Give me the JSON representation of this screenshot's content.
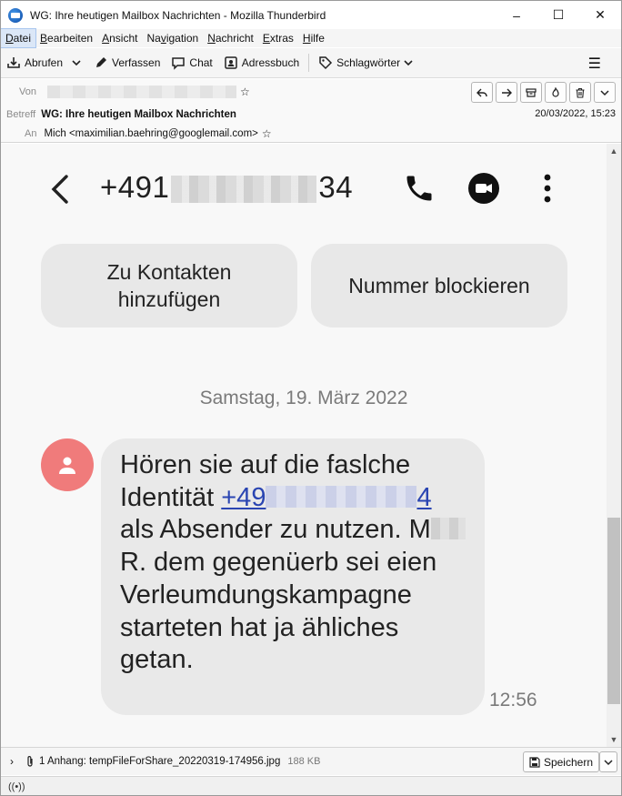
{
  "window": {
    "title": "WG: Ihre heutigen Mailbox Nachrichten - Mozilla Thunderbird",
    "minimize": "–",
    "maximize": "☐",
    "close": "✕"
  },
  "menubar": {
    "items": [
      {
        "first": "D",
        "rest": "atei"
      },
      {
        "first": "B",
        "rest": "earbeiten"
      },
      {
        "first": "A",
        "rest": "nsicht"
      },
      {
        "pre": "Na",
        "first": "v",
        "rest": "igation"
      },
      {
        "first": "N",
        "rest": "achricht"
      },
      {
        "first": "E",
        "rest": "xtras"
      },
      {
        "first": "H",
        "rest": "ilfe"
      }
    ]
  },
  "toolbar": {
    "get_mail": "Abrufen",
    "compose": "Verfassen",
    "chat": "Chat",
    "address_book": "Adressbuch",
    "tags": "Schlagwörter",
    "menu_icon": "☰"
  },
  "header": {
    "from_label": "Von",
    "subject_label": "Betreff",
    "subject": "WG: Ihre heutigen Mailbox Nachrichten",
    "date": "20/03/2022, 15:23",
    "to_label": "An",
    "to": "Mich <maximilian.baehring@googlemail.com>",
    "star": "☆"
  },
  "sms": {
    "phone_prefix": "+491",
    "phone_suffix": "34",
    "add_contact_line1": "Zu Kontakten",
    "add_contact_line2": "hinzufügen",
    "block_number": "Nummer blockieren",
    "date": "Samstag, 19. März 2022",
    "message_part1": "Hören sie auf die faslche Identität ",
    "message_link_prefix": "+49",
    "message_link_suffix": "4",
    "message_part2": " als Absender zu nutzen. M",
    "message_part3": " R. dem gegenüerb sei eien Verleumdungskampagne starteten hat ja ähliches getan.",
    "time": "12:56"
  },
  "attachment": {
    "toggle": "›",
    "label": "1 Anhang: tempFileForShare_20220319-174956.jpg",
    "size": "188 KB",
    "save": "Speichern"
  },
  "status": {
    "icon": "((•))"
  }
}
